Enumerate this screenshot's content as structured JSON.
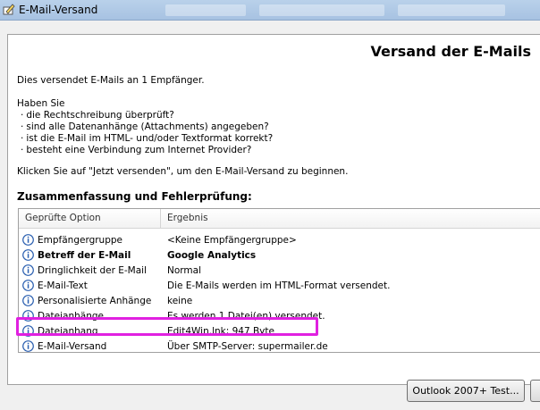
{
  "window": {
    "title": "E-Mail-Versand"
  },
  "page": {
    "heading": "Versand der E-Mails",
    "intro": "Dies versendet E-Mails an 1 Empfänger.",
    "question": "Haben Sie",
    "checklist": [
      "die Rechtschreibung überprüft?",
      "sind alle Datenanhänge (Attachments) angegeben?",
      "ist die E-Mail im HTML- und/oder Textformat korrekt?",
      "besteht eine Verbindung zum Internet Provider?"
    ],
    "instruction": "Klicken Sie auf \"Jetzt versenden\", um den E-Mail-Versand zu beginnen.",
    "section_title": "Zusammenfassung und Fehlerprüfung:"
  },
  "table": {
    "headers": [
      "Geprüfte Option",
      "Ergebnis"
    ],
    "rows": [
      {
        "option": "Empfängergruppe",
        "result": "<Keine Empfängergruppe>",
        "bold": false
      },
      {
        "option": "Betreff der E-Mail",
        "result": "Google Analytics",
        "bold": true
      },
      {
        "option": "Dringlichkeit der E-Mail",
        "result": "Normal",
        "bold": false
      },
      {
        "option": "E-Mail-Text",
        "result": "Die E-Mails werden im HTML-Format versendet.",
        "bold": false
      },
      {
        "option": "Personalisierte Anhänge",
        "result": "keine",
        "bold": false
      },
      {
        "option": "Dateianhänge",
        "result": "Es werden 1 Datei(en) versendet.",
        "bold": false
      },
      {
        "option": "Dateianhang",
        "result": "Edit4Win.lnk; 947 Byte",
        "bold": false
      },
      {
        "option": "E-Mail-Versand",
        "result": "Über SMTP-Server: supermailer.de",
        "bold": false
      }
    ]
  },
  "buttons": {
    "outlook_label": "Outlook 2007+ Test..."
  },
  "colors": {
    "highlight": "#e020e0",
    "info_icon": "#2a5fb0"
  }
}
